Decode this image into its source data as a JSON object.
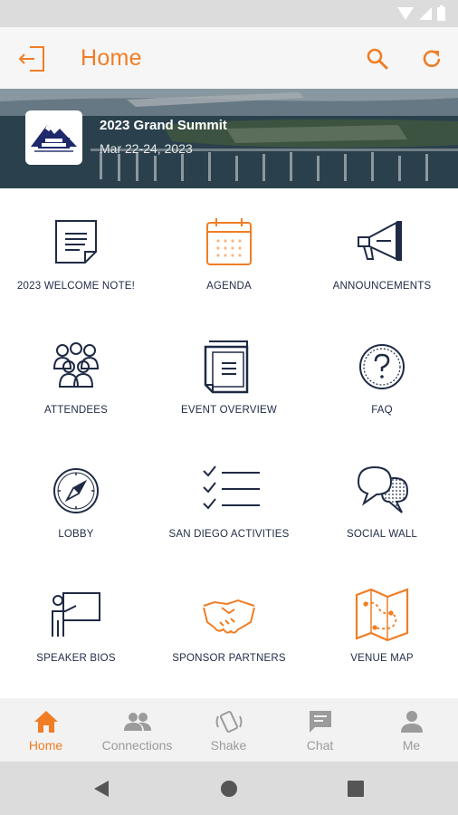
{
  "appbar": {
    "title": "Home"
  },
  "event": {
    "title": "2023 Grand Summit",
    "dates": "Mar 22-24, 2023"
  },
  "grid": [
    {
      "label": "2023 WELCOME NOTE!",
      "icon": "document-icon"
    },
    {
      "label": "AGENDA",
      "icon": "calendar-icon"
    },
    {
      "label": "ANNOUNCEMENTS",
      "icon": "megaphone-icon"
    },
    {
      "label": "ATTENDEES",
      "icon": "people-icon"
    },
    {
      "label": "EVENT OVERVIEW",
      "icon": "stacked-docs-icon"
    },
    {
      "label": "FAQ",
      "icon": "question-icon"
    },
    {
      "label": "LOBBY",
      "icon": "compass-icon"
    },
    {
      "label": "SAN DIEGO ACTIVITIES",
      "icon": "checklist-icon"
    },
    {
      "label": "SOCIAL WALL",
      "icon": "chat-bubbles-icon"
    },
    {
      "label": "SPEAKER BIOS",
      "icon": "presenter-icon"
    },
    {
      "label": "SPONSOR PARTNERS",
      "icon": "handshake-icon"
    },
    {
      "label": "VENUE MAP",
      "icon": "map-icon"
    }
  ],
  "bottom_nav": [
    {
      "label": "Home",
      "icon": "home-icon",
      "active": true
    },
    {
      "label": "Connections",
      "icon": "connections-icon",
      "active": false
    },
    {
      "label": "Shake",
      "icon": "shake-icon",
      "active": false
    },
    {
      "label": "Chat",
      "icon": "chat-icon",
      "active": false
    },
    {
      "label": "Me",
      "icon": "person-icon",
      "active": false
    }
  ],
  "colors": {
    "accent": "#f07d24",
    "navy": "#1f2a44",
    "inactive": "#9b9b9b"
  }
}
